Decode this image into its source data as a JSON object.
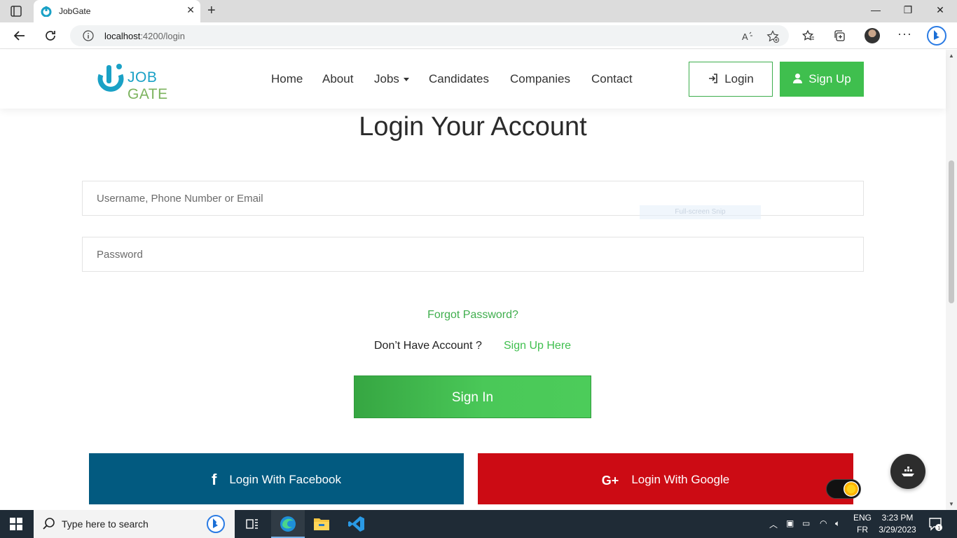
{
  "browser": {
    "tab_title": "JobGate",
    "url_host": "localhost",
    "url_path": ":4200/login"
  },
  "header": {
    "logo_part1": "JOB",
    "logo_part2": "GATE",
    "nav": [
      "Home",
      "About",
      "Jobs",
      "Candidates",
      "Companies",
      "Contact"
    ],
    "login_label": "Login",
    "signup_label": "Sign Up"
  },
  "main": {
    "title": "Login Your Account",
    "username_placeholder": "Username, Phone Number or Email",
    "password_placeholder": "Password",
    "snip_hint": "Full-screen Snip",
    "forgot": "Forgot Password?",
    "no_account": "Don’t Have Account ?",
    "signup_here": "Sign Up Here",
    "signin": "Sign In",
    "facebook": "Login With Facebook",
    "google": "Login With Google",
    "facebook_icon_glyph": "f",
    "google_icon_glyph": "G+"
  },
  "taskbar": {
    "search_placeholder": "Type here to search",
    "lang_line1": "ENG",
    "lang_line2": "FR",
    "time": "3:23 PM",
    "date": "3/29/2023",
    "notification_count": "1"
  },
  "colors": {
    "brand_green": "#3fbf4e",
    "brand_blue": "#1aa1c6",
    "facebook": "#025a80",
    "google": "#cc0b14"
  }
}
